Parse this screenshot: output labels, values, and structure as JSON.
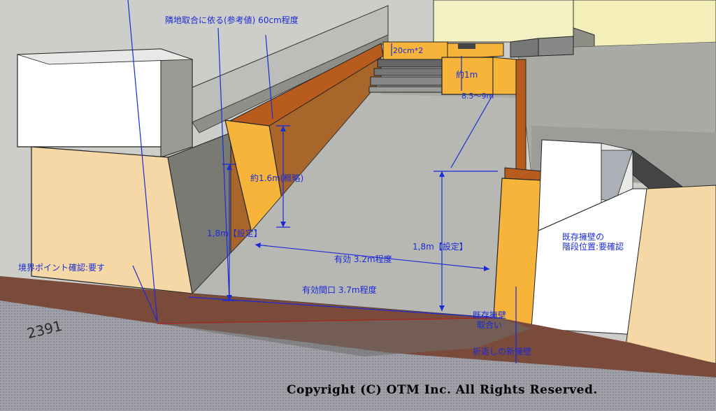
{
  "labels": {
    "neighbor_clearance": "隣地取合に依る(参考値) 60cm程度",
    "step_height": "20cm*2",
    "approx_1m": "約1m",
    "range_8_9m": "8.5～9m",
    "approx_1_6m": "約1.6m(概略)",
    "height_left": "1,8m【設定】",
    "height_right": "1,8m【設定】",
    "effective_width": "有効 3.2m程度",
    "effective_opening": "有効間口 3.7m程度",
    "boundary_point": "境界ポイント確認:要す",
    "existing_wall_stair": "既存擁壁の\n階段位置:要確認",
    "existing_wall_junction": "既存擁壁\n取合い",
    "new_return_wall": "折返しの新擁壁"
  },
  "plot_number": "2391",
  "copyright": "Copyright (C) OTM Inc. All Rights Reserved.",
  "colors": {
    "annotation": "#1a2bd6",
    "retaining_wall": "#f6b53a",
    "wall_top": "#b85c1e",
    "ground": "#7a4a3a",
    "slab": "#b7b7b3"
  }
}
